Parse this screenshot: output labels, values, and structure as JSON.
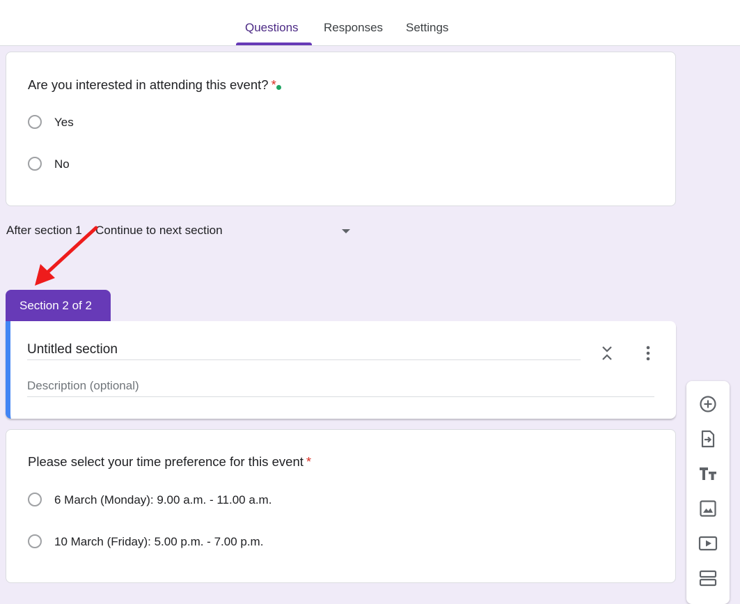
{
  "tabs": [
    {
      "label": "Questions",
      "active": true
    },
    {
      "label": "Responses",
      "active": false
    },
    {
      "label": "Settings",
      "active": false
    }
  ],
  "question1": {
    "title": "Are you interested in attending this event?",
    "required_mark": "*",
    "options": [
      "Yes",
      "No"
    ]
  },
  "after_section": {
    "prefix": "After section 1",
    "value": "Continue to next section"
  },
  "section2": {
    "tab_label": "Section 2 of 2",
    "title": "Untitled section",
    "description_placeholder": "Description (optional)"
  },
  "question2": {
    "title": "Please select your time preference for this event",
    "required_mark": "*",
    "options": [
      "6 March (Monday): 9.00 a.m. - 11.00 a.m.",
      "10 March (Friday): 5.00 p.m. - 7.00 p.m."
    ]
  },
  "toolbar_icons": [
    "add-question-icon",
    "import-questions-icon",
    "add-title-icon",
    "add-image-icon",
    "add-video-icon",
    "add-section-icon"
  ],
  "colors": {
    "accent": "#673ab7",
    "section_border": "#4285f4",
    "annotation_arrow": "#ee1c1c",
    "required": "#d93025",
    "background": "#f0ebf8"
  }
}
